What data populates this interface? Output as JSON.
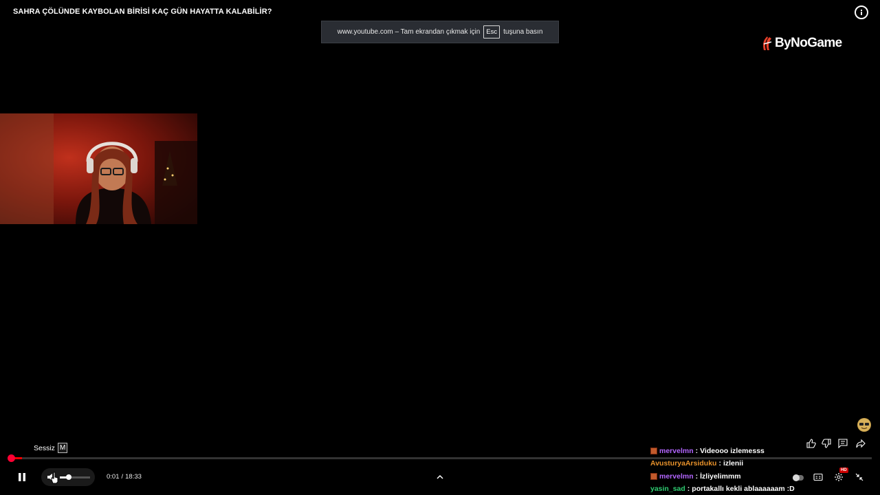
{
  "video": {
    "title": "SAHRA ÇÖLÜNDE KAYBOLAN BİRİSİ KAÇ GÜN HAYATTA KALABİLİR?"
  },
  "fullscreen_notice": {
    "site": "www.youtube.com – Tam ekrandan çıkmak için",
    "key": "Esc",
    "suffix": "tuşuna basın"
  },
  "brand": {
    "name": "ByNoGame",
    "logo_color": "#e8402a"
  },
  "mute_hint": {
    "label": "Sessiz",
    "key": "M"
  },
  "player": {
    "progress_fraction": 0.0009,
    "volume_fraction": 0.3,
    "time_current": "0:01",
    "time_separator": "/",
    "time_total": "18:33",
    "accent_color": "#ff0000"
  },
  "icons": {
    "info": "info-icon",
    "pause": "pause-icon",
    "volume": "volume-icon",
    "chevron": "chevron-up-icon",
    "like": "thumbs-up-icon",
    "dislike": "thumbs-down-icon",
    "comment": "comment-icon",
    "share": "share-icon",
    "autoplay": "autoplay-toggle",
    "subtitles": "subtitles-icon",
    "settings": "settings-icon",
    "exit_fullscreen": "exit-fullscreen-icon"
  },
  "settings_badge": "HD",
  "chat": [
    {
      "user": "mervelmn",
      "color": "#b366ff",
      "badge": true,
      "sep": ":",
      "text": "Videooo izlemesss"
    },
    {
      "user": "AvusturyaArsiduku",
      "color": "#e8922b",
      "badge": false,
      "sep": ":",
      "text": "izlenii"
    },
    {
      "user": "mervelmn",
      "color": "#b366ff",
      "badge": true,
      "sep": ":",
      "text": "İzliyelimmm"
    },
    {
      "user": "yasin_sad",
      "color": "#2ecc71",
      "badge": false,
      "sep": ":",
      "text": "portakallı kekli ablaaaaaam :D"
    }
  ]
}
